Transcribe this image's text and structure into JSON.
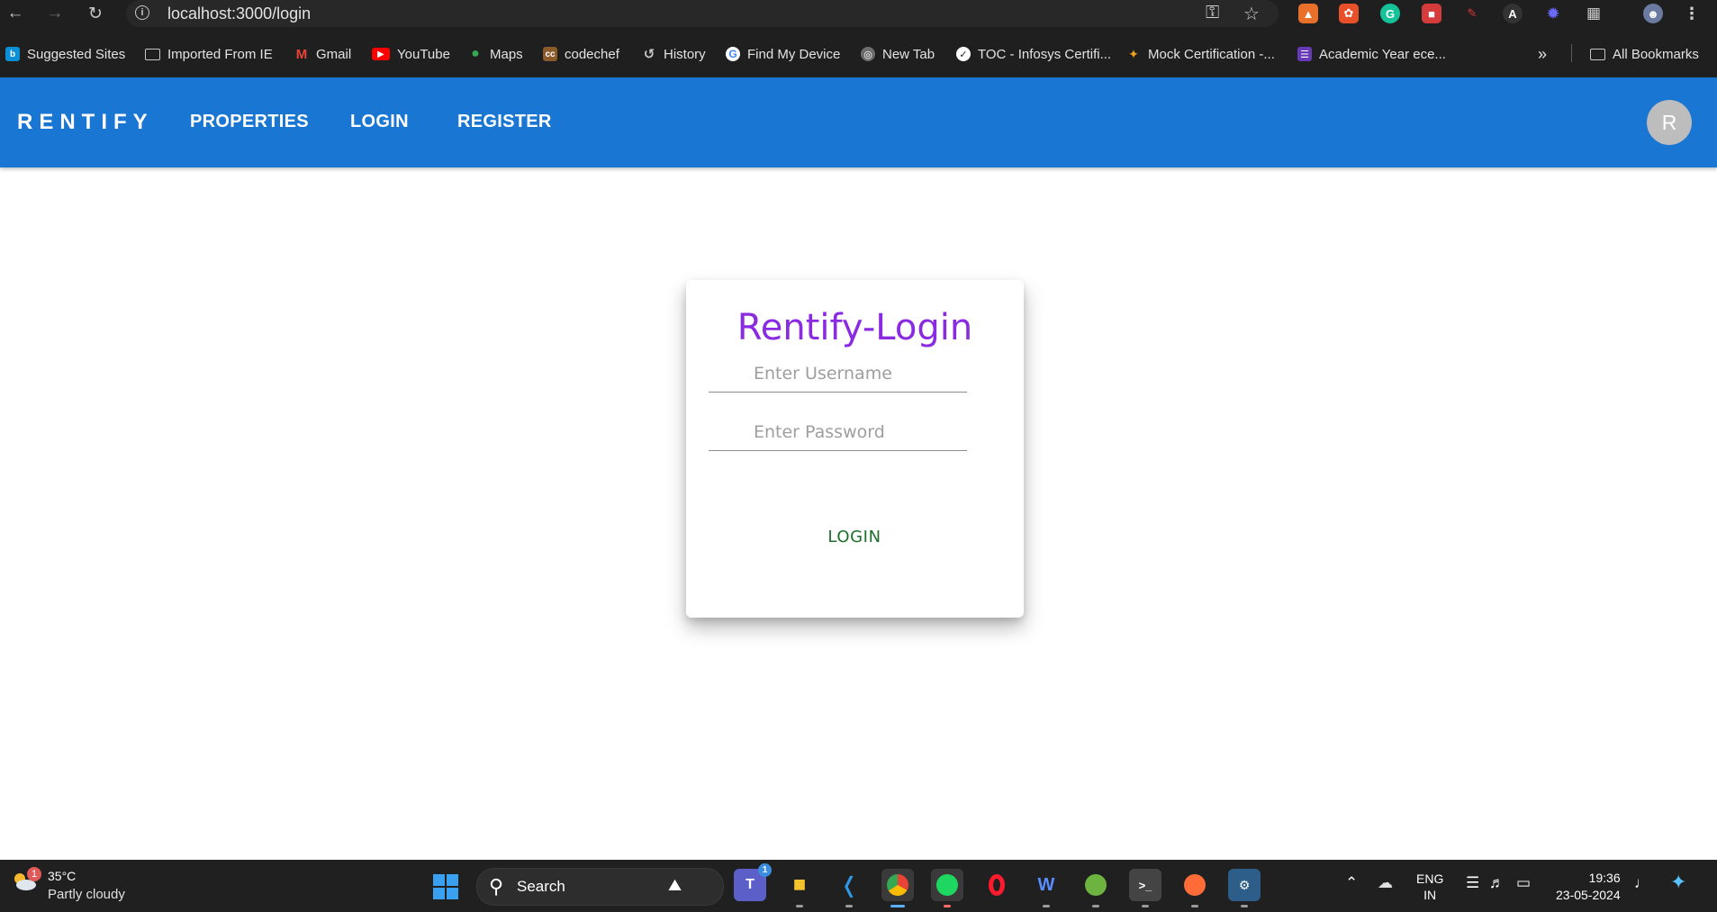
{
  "browser": {
    "url": "localhost:3000/login",
    "bookmarks": [
      {
        "label": "Suggested Sites",
        "icon": "bing-icon",
        "color": "#0b8fd6"
      },
      {
        "label": "Imported From IE",
        "icon": "folder-icon"
      },
      {
        "label": "Gmail",
        "icon": "gmail-icon",
        "color": "#ea4335"
      },
      {
        "label": "YouTube",
        "icon": "youtube-icon",
        "color": "#ff0000"
      },
      {
        "label": "Maps",
        "icon": "maps-icon",
        "color": "#34a853"
      },
      {
        "label": "codechef",
        "icon": "codechef-icon",
        "color": "#8b5a2b"
      },
      {
        "label": "History",
        "icon": "history-icon"
      },
      {
        "label": "Find My Device",
        "icon": "google-icon",
        "color": "#4285f4"
      },
      {
        "label": "New Tab",
        "icon": "globe-icon"
      },
      {
        "label": "TOC - Infosys Certifi...",
        "icon": "infosys-icon"
      },
      {
        "label": "Mock Certification -...",
        "icon": "mock-cert-icon",
        "color": "#f0a020"
      },
      {
        "label": "Academic Year ece...",
        "icon": "forms-icon",
        "color": "#673ab7"
      }
    ],
    "all_bookmarks": "All Bookmarks"
  },
  "app": {
    "brand": "RENTIFY",
    "nav": {
      "properties": "PROPERTIES",
      "login": "LOGIN",
      "register": "REGISTER"
    },
    "avatar_initial": "R",
    "accent_color": "#1976d2"
  },
  "login": {
    "title": "Rentify-Login",
    "username_placeholder": "Enter Username",
    "password_placeholder": "Enter Password",
    "username_value": "",
    "password_value": "",
    "button": "LOGIN"
  },
  "taskbar": {
    "weather_temp": "35°C",
    "weather_desc": "Partly cloudy",
    "weather_badge": "1",
    "search": "Search",
    "teams_badge": "1",
    "lang_line1": "ENG",
    "lang_line2": "IN",
    "time": "19:36",
    "date": "23-05-2024"
  }
}
